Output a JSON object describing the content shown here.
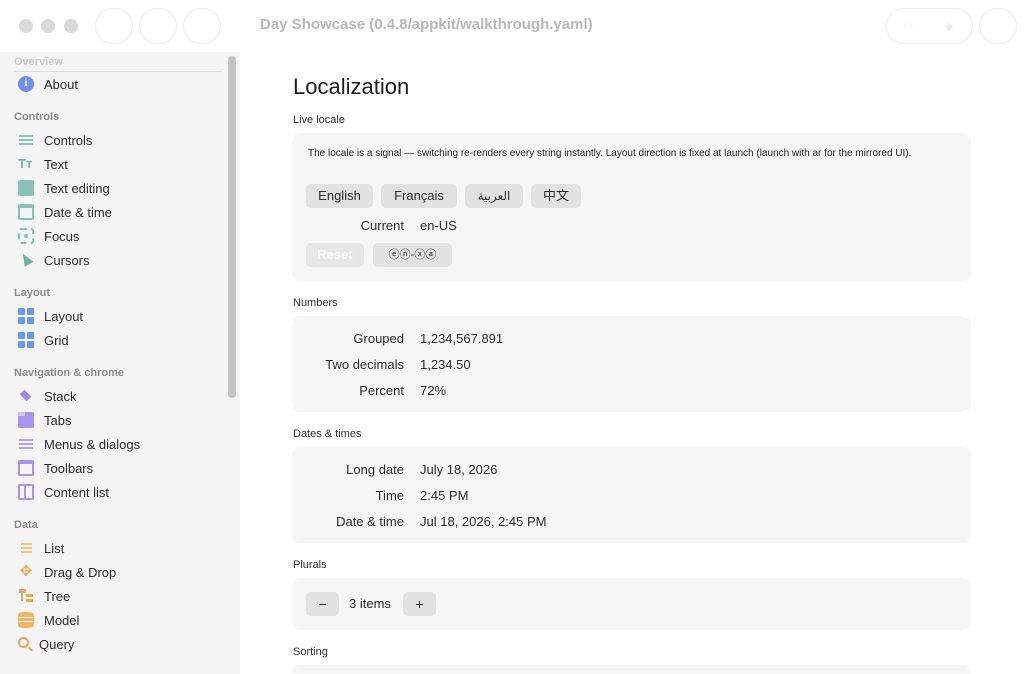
{
  "window": {
    "title": "Day Showcase (0.4.8/appkit/walkthrough.yaml)"
  },
  "sidebar": {
    "faded_header": "Overview",
    "sections": [
      {
        "label": "Controls"
      },
      {
        "label": "Layout"
      },
      {
        "label": "Navigation & chrome"
      },
      {
        "label": "Data"
      }
    ],
    "items": [
      {
        "label": "About",
        "icon": "info-icon"
      },
      {
        "label": "Controls",
        "icon": "sliders-icon"
      },
      {
        "label": "Text",
        "icon": "text-icon"
      },
      {
        "label": "Text editing",
        "icon": "edit-icon"
      },
      {
        "label": "Date & time",
        "icon": "calendar-icon"
      },
      {
        "label": "Focus",
        "icon": "focus-icon"
      },
      {
        "label": "Cursors",
        "icon": "cursor-icon"
      },
      {
        "label": "Layout",
        "icon": "layout-icon"
      },
      {
        "label": "Grid",
        "icon": "grid-icon"
      },
      {
        "label": "Stack",
        "icon": "stack-icon"
      },
      {
        "label": "Tabs",
        "icon": "tabs-icon"
      },
      {
        "label": "Menus & dialogs",
        "icon": "menu-icon"
      },
      {
        "label": "Toolbars",
        "icon": "toolbar-icon"
      },
      {
        "label": "Content list",
        "icon": "content-list-icon"
      },
      {
        "label": "List",
        "icon": "list-icon"
      },
      {
        "label": "Drag & Drop",
        "icon": "drag-icon"
      },
      {
        "label": "Tree",
        "icon": "tree-icon"
      },
      {
        "label": "Model",
        "icon": "database-icon"
      },
      {
        "label": "Query",
        "icon": "search-icon"
      }
    ]
  },
  "main": {
    "title": "Localization",
    "live_locale": {
      "label": "Live locale",
      "description": "The locale is a signal — switching re-renders every string instantly. Layout direction is fixed at launch (launch with ar for the mirrored UI).",
      "locales": [
        "English",
        "Français",
        "العربية",
        "中文"
      ],
      "current_key": "Current",
      "current_value": "en-US",
      "reset_label": "Reset",
      "pseudo_label": "ⓔⓝ-ⓧⓐ"
    },
    "numbers": {
      "label": "Numbers",
      "rows": [
        {
          "key": "Grouped",
          "value": "1,234,567.891"
        },
        {
          "key": "Two decimals",
          "value": "1,234.50"
        },
        {
          "key": "Percent",
          "value": "72%"
        }
      ]
    },
    "dates": {
      "label": "Dates & times",
      "rows": [
        {
          "key": "Long date",
          "value": "July 18, 2026"
        },
        {
          "key": "Time",
          "value": "2:45 PM"
        },
        {
          "key": "Date & time",
          "value": "Jul 18, 2026, 2:45 PM"
        }
      ]
    },
    "plurals": {
      "label": "Plurals",
      "minus": "−",
      "value": "3 items",
      "plus": "+"
    },
    "sorting": {
      "label": "Sorting"
    }
  }
}
